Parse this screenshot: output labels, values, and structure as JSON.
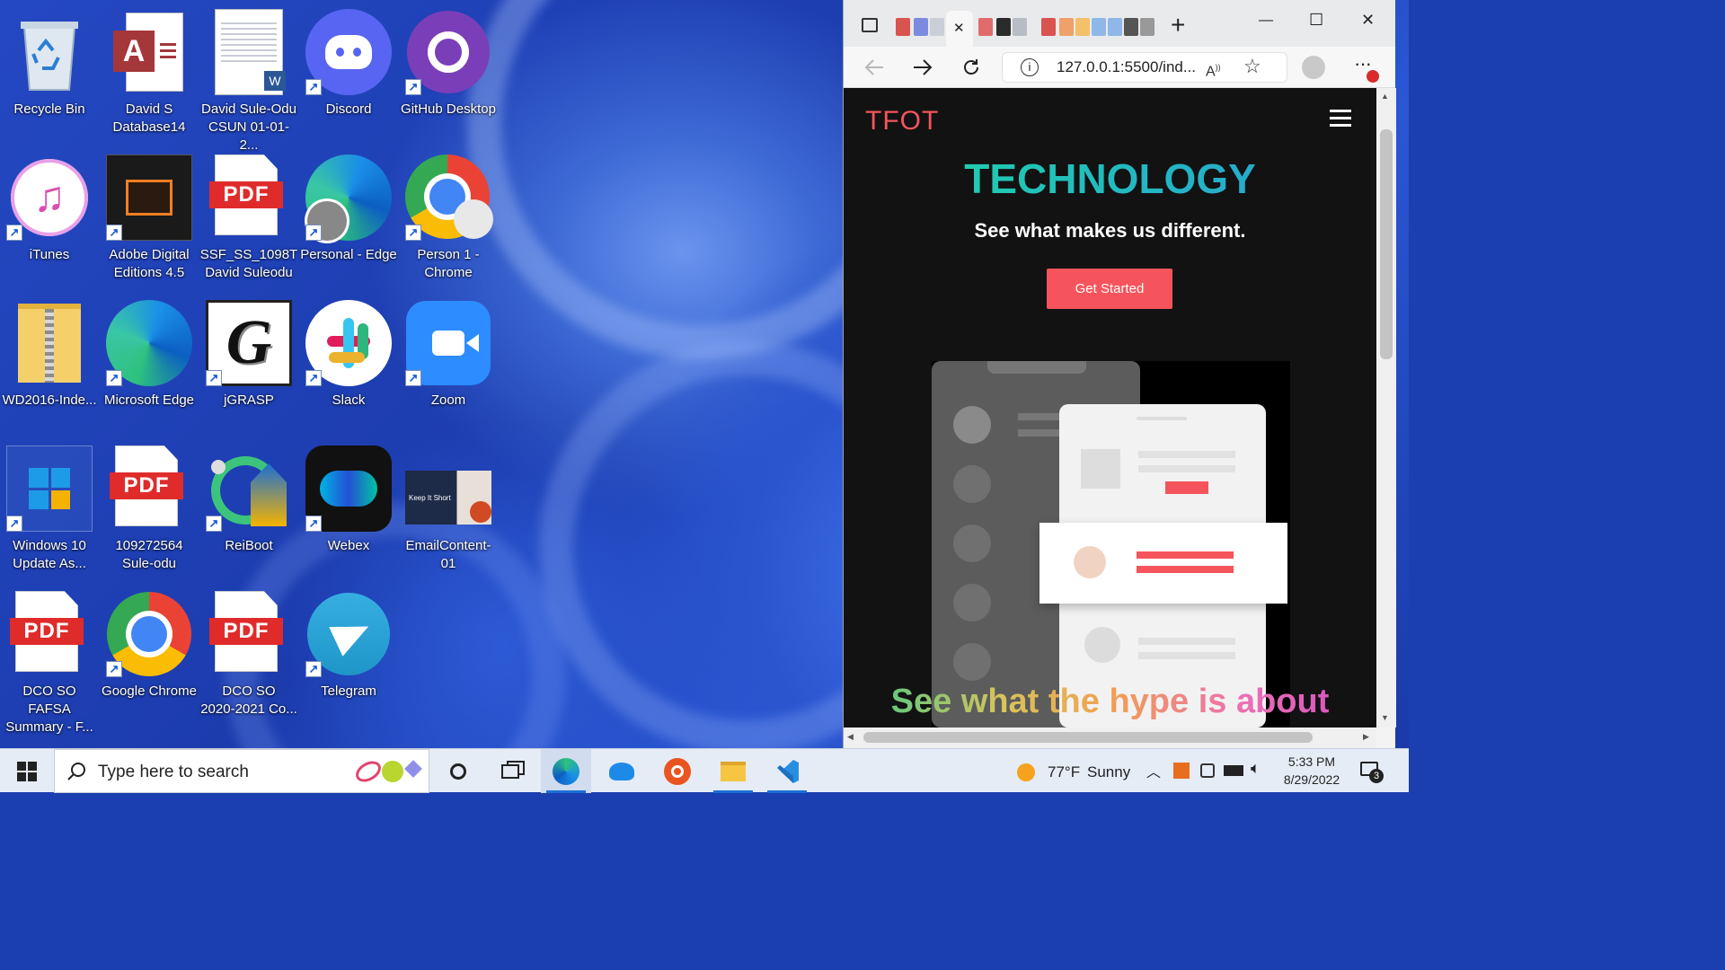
{
  "desktop": {
    "icons": [
      {
        "label": "Recycle Bin",
        "icon": "recycle-bin-icon"
      },
      {
        "label": "David S\nDatabase14",
        "icon": "access-database-icon"
      },
      {
        "label": "David Sule-Odu\nCSUN 01-01-2...",
        "icon": "word-document-icon"
      },
      {
        "label": "Discord",
        "icon": "discord-icon"
      },
      {
        "label": "GitHub Desktop",
        "icon": "github-desktop-icon"
      },
      {
        "label": "iTunes",
        "icon": "itunes-icon"
      },
      {
        "label": "Adobe Digital\nEditions 4.5",
        "icon": "adobe-digital-editions-icon"
      },
      {
        "label": "SSF_SS_1098T\nDavid Suleodu",
        "icon": "pdf-icon"
      },
      {
        "label": "Personal - Edge",
        "icon": "edge-profile-icon"
      },
      {
        "label": "Person 1 -\nChrome",
        "icon": "chrome-profile-icon"
      },
      {
        "label": "WD2016-Inde...",
        "icon": "zip-folder-icon"
      },
      {
        "label": "Microsoft Edge",
        "icon": "edge-icon"
      },
      {
        "label": "jGRASP",
        "icon": "jgrasp-icon"
      },
      {
        "label": "Slack",
        "icon": "slack-icon"
      },
      {
        "label": "Zoom",
        "icon": "zoom-icon"
      },
      {
        "label": "Windows 10\nUpdate As...",
        "icon": "windows-update-icon"
      },
      {
        "label": "109272564\nSule-odu",
        "icon": "pdf-icon"
      },
      {
        "label": "ReiBoot",
        "icon": "reiboot-icon"
      },
      {
        "label": "Webex",
        "icon": "webex-icon"
      },
      {
        "label": "EmailContent-01",
        "icon": "powerpoint-file-icon"
      },
      {
        "label": "DCO SO FAFSA\nSummary - F...",
        "icon": "pdf-icon"
      },
      {
        "label": "Google Chrome",
        "icon": "chrome-icon"
      },
      {
        "label": "DCO SO\n2020-2021 Co...",
        "icon": "pdf-icon"
      },
      {
        "label": "Telegram",
        "icon": "telegram-icon"
      }
    ],
    "pdf_tag": "PDF",
    "pptx_thumb_text": "Keep It Short",
    "jgrasp_letter": "G",
    "access_letter": "A",
    "word_letter": "W",
    "shortcut_glyph": "↗"
  },
  "browser": {
    "url": "127.0.0.1:5500/ind...",
    "new_tab_glyph": "+",
    "close_tab_glyph": "✕",
    "window_controls": {
      "minimize": "—",
      "maximize": "☐",
      "close": "✕"
    },
    "site": {
      "logo": "TFOT",
      "hero_title": "TECHNOLOGY",
      "hero_subtitle": "See what makes us different.",
      "cta_label": "Get Started",
      "section_heading": "See what the hype is about"
    },
    "accent_color": "#f6545c"
  },
  "taskbar": {
    "search_placeholder": "Type here to search",
    "weather_temp": "77°F",
    "weather_desc": "Sunny",
    "time": "5:33 PM",
    "date": "8/29/2022",
    "notification_count": "3"
  }
}
